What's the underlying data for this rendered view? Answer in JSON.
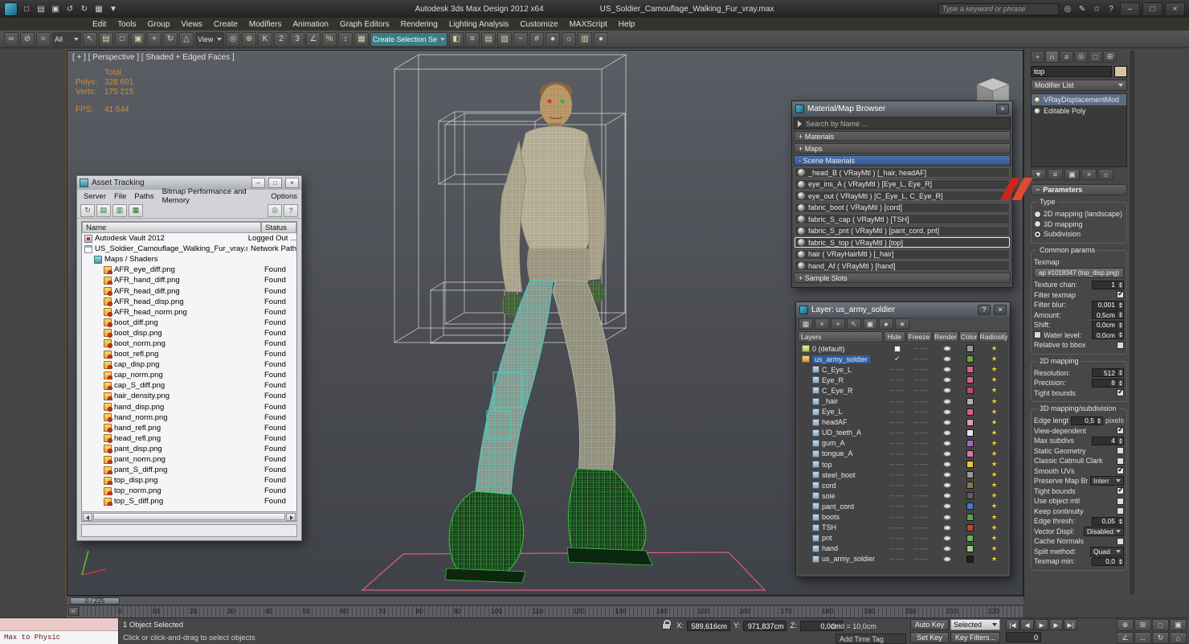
{
  "titlebar": {
    "app_title": "Autodesk 3ds Max Design 2012 x64",
    "file_title": "US_Soldier_Camouflage_Walking_Fur_vray.max",
    "search_placeholder": "Type a keyword or phrase",
    "min": "–",
    "max": "□",
    "close": "×",
    "quick_icons": [
      {
        "n": "new-scene-icon",
        "g": "□"
      },
      {
        "n": "open-file-icon",
        "g": "▤"
      },
      {
        "n": "save-file-icon",
        "g": "▣"
      },
      {
        "n": "undo-icon",
        "g": "↺"
      },
      {
        "n": "redo-icon",
        "g": "↻"
      },
      {
        "n": "project-folder-icon",
        "g": "▦"
      },
      {
        "n": "quick-access-dropdown-icon",
        "g": "▼"
      }
    ],
    "search_icons": [
      {
        "n": "search-icon",
        "g": "◎"
      },
      {
        "n": "pen-icon",
        "g": "✎"
      },
      {
        "n": "favorites-star-icon",
        "g": "☆"
      },
      {
        "n": "help-icon",
        "g": "?"
      }
    ]
  },
  "menubar": [
    "Edit",
    "Tools",
    "Group",
    "Views",
    "Create",
    "Modifiers",
    "Animation",
    "Graph Editors",
    "Rendering",
    "Lighting Analysis",
    "Customize",
    "MAXScript",
    "Help"
  ],
  "toolbar": [
    {
      "n": "select-and-link-icon",
      "g": "∞"
    },
    {
      "n": "unlink-selection-icon",
      "g": "⊘"
    },
    {
      "n": "bind-to-spacewarp-icon",
      "g": "≈"
    },
    {
      "n": "selection-filter-dropdown",
      "g": "All",
      "drop": true
    },
    {
      "n": "select-object-icon",
      "g": "↖"
    },
    {
      "n": "select-by-name-icon",
      "g": "▤"
    },
    {
      "n": "selection-region-icon",
      "g": "□"
    },
    {
      "n": "window-crossing-icon",
      "g": "▣"
    },
    {
      "n": "select-and-move-icon",
      "g": "+"
    },
    {
      "n": "select-and-rotate-icon",
      "g": "↻"
    },
    {
      "n": "select-and-scale-icon",
      "g": "△"
    },
    {
      "n": "reference-coordinate-dropdown",
      "g": "View",
      "drop": true
    },
    {
      "n": "use-center-icon",
      "g": "◎"
    },
    {
      "n": "select-and-manipulate-icon",
      "g": "⊕"
    },
    {
      "n": "keyboard-override-icon",
      "g": "K"
    },
    {
      "n": "snap-2d-icon",
      "g": "2"
    },
    {
      "n": "snap-3d-icon",
      "g": "3"
    },
    {
      "n": "angle-snap-icon",
      "g": "∠"
    },
    {
      "n": "percent-snap-icon",
      "g": "%"
    },
    {
      "n": "spinner-snap-icon",
      "g": "↕"
    },
    {
      "n": "edit-selection-sets-icon",
      "g": "▦"
    },
    {
      "n": "named-selection-dropdown",
      "g": "Create Selection Se",
      "drop": true,
      "teal": true
    },
    {
      "n": "mirror-icon",
      "g": "◧"
    },
    {
      "n": "align-icon",
      "g": "≡"
    },
    {
      "n": "layer-manager-icon",
      "g": "▤"
    },
    {
      "n": "graphite-ribbon-icon",
      "g": "▧"
    },
    {
      "n": "curve-editor-icon",
      "g": "~"
    },
    {
      "n": "schematic-view-icon",
      "g": "#"
    },
    {
      "n": "material-editor-icon",
      "g": "●"
    },
    {
      "n": "render-setup-icon",
      "g": "☼"
    },
    {
      "n": "rendered-frame-icon",
      "g": "▥"
    },
    {
      "n": "render-production-icon",
      "g": "●"
    }
  ],
  "viewport": {
    "label": "[ + ] [ Perspective ] [ Shaded + Edged Faces ]",
    "stats": {
      "total_label": "Total",
      "polys_label": "Polys:",
      "polys": "328 601",
      "verts_label": "Verts:",
      "verts": "175 215",
      "fps_label": "FPS:",
      "fps": "41 644"
    }
  },
  "asset_tracking": {
    "title": "Asset Tracking",
    "min": "–",
    "max": "□",
    "close": "×",
    "menus": [
      "Server",
      "File",
      "Paths",
      "Bitmap Performance and Memory",
      "Options"
    ],
    "tools_left": [
      {
        "n": "refresh-icon",
        "g": "↻"
      },
      {
        "n": "table-view-icon",
        "g": "▤"
      },
      {
        "n": "details-view-icon",
        "g": "▥"
      },
      {
        "n": "list-view-icon",
        "g": "▦"
      }
    ],
    "tools_right": [
      {
        "n": "settings-icon",
        "g": "◎"
      },
      {
        "n": "asset-help-icon",
        "g": "?"
      }
    ],
    "columns": [
      "Name",
      "Status"
    ],
    "rows": [
      {
        "name": "Autodesk Vault 2012",
        "status": "Logged Out ...",
        "icon": "vault-icon",
        "depth": "d0"
      },
      {
        "name": "US_Soldier_Camouflage_Walking_Fur_vray.max",
        "status": "Network Path",
        "icon": "file-icon",
        "depth": "d0"
      },
      {
        "name": "Maps / Shaders",
        "status": "",
        "icon": "folder-icon",
        "depth": "d1"
      },
      {
        "name": "AFR_eye_diff.png",
        "status": "Found",
        "icon": "bitmap-icon",
        "depth": "d2"
      },
      {
        "name": "AFR_hand_diff.png",
        "status": "Found",
        "icon": "bitmap-icon",
        "depth": "d2"
      },
      {
        "name": "AFR_head_diff.png",
        "status": "Found",
        "icon": "bitmap-icon",
        "depth": "d2"
      },
      {
        "name": "AFR_head_disp.png",
        "status": "Found",
        "icon": "bitmap-icon",
        "depth": "d2"
      },
      {
        "name": "AFR_head_norm.png",
        "status": "Found",
        "icon": "bitmap-icon",
        "depth": "d2"
      },
      {
        "name": "boot_diff.png",
        "status": "Found",
        "icon": "bitmap-icon",
        "depth": "d2"
      },
      {
        "name": "boot_disp.png",
        "status": "Found",
        "icon": "bitmap-icon",
        "depth": "d2"
      },
      {
        "name": "boot_norm.png",
        "status": "Found",
        "icon": "bitmap-icon",
        "depth": "d2"
      },
      {
        "name": "boot_refl.png",
        "status": "Found",
        "icon": "bitmap-icon",
        "depth": "d2"
      },
      {
        "name": "cap_disp.png",
        "status": "Found",
        "icon": "bitmap-icon",
        "depth": "d2"
      },
      {
        "name": "cap_norm.png",
        "status": "Found",
        "icon": "bitmap-icon",
        "depth": "d2"
      },
      {
        "name": "cap_S_diff.png",
        "status": "Found",
        "icon": "bitmap-icon",
        "depth": "d2"
      },
      {
        "name": "hair_density.png",
        "status": "Found",
        "icon": "bitmap-icon",
        "depth": "d2"
      },
      {
        "name": "hand_disp.png",
        "status": "Found",
        "icon": "bitmap-icon",
        "depth": "d2"
      },
      {
        "name": "hand_norm.png",
        "status": "Found",
        "icon": "bitmap-icon",
        "depth": "d2"
      },
      {
        "name": "hand_refl.png",
        "status": "Found",
        "icon": "bitmap-icon",
        "depth": "d2"
      },
      {
        "name": "head_refl.png",
        "status": "Found",
        "icon": "bitmap-icon",
        "depth": "d2"
      },
      {
        "name": "pant_disp.png",
        "status": "Found",
        "icon": "bitmap-icon",
        "depth": "d2"
      },
      {
        "name": "pant_norm.png",
        "status": "Found",
        "icon": "bitmap-icon",
        "depth": "d2"
      },
      {
        "name": "pant_S_diff.png",
        "status": "Found",
        "icon": "bitmap-icon",
        "depth": "d2"
      },
      {
        "name": "top_disp.png",
        "status": "Found",
        "icon": "bitmap-icon",
        "depth": "d2"
      },
      {
        "name": "top_norm.png",
        "status": "Found",
        "icon": "bitmap-icon",
        "depth": "d2"
      },
      {
        "name": "top_S_diff.png",
        "status": "Found",
        "icon": "bitmap-icon",
        "depth": "d2"
      }
    ]
  },
  "material_browser": {
    "title": "Material/Map Browser",
    "close": "×",
    "search_placeholder": "Search by Name ...",
    "rollups": [
      "+ Materials",
      "+ Maps",
      "- Scene Materials",
      "+ Sample Slots"
    ],
    "items": [
      {
        "label": "_head_B ( VRayMtl ) [_hair, headAF]",
        "sel": false
      },
      {
        "label": "eye_ins_A ( VRayMtl ) [Eye_L, Eye_R]",
        "sel": false
      },
      {
        "label": "eye_out ( VRayMtl ) [C_Eye_L, C_Eye_R]",
        "sel": false
      },
      {
        "label": "fabric_boot ( VRayMtl ) [cord]",
        "sel": false
      },
      {
        "label": "fabric_S_cap ( VRayMtl ) [TSH]",
        "sel": false
      },
      {
        "label": "fabric_S_pnt ( VRayMtl ) [pant_cord, pnt]",
        "sel": false
      },
      {
        "label": "fabric_S_top ( VRayMtl ) [top]",
        "sel": true
      },
      {
        "label": "hair ( VRayHairMtl ) [_hair]",
        "sel": false
      },
      {
        "label": "hand_Af ( VRayMtl ) [hand]",
        "sel": false
      }
    ]
  },
  "layer_manager": {
    "title": "Layer: us_army_soldier",
    "help": "?",
    "close": "×",
    "tools": [
      {
        "n": "new-layer-icon",
        "g": "▦"
      },
      {
        "n": "delete-layer-icon",
        "g": "×"
      },
      {
        "n": "add-to-layer-icon",
        "g": "+"
      },
      {
        "n": "select-in-layer-icon",
        "g": "↖"
      },
      {
        "n": "highlight-layer-icon",
        "g": "▣"
      },
      {
        "n": "hide-all-icon",
        "g": "●"
      },
      {
        "n": "freeze-all-icon",
        "g": "∗"
      }
    ],
    "columns": [
      "Layers",
      "Hide",
      "Freeze",
      "Render",
      "Color",
      "Radiosity"
    ],
    "rows": [
      {
        "name": "0 (default)",
        "kind": "layer0",
        "sel": false,
        "hide": "",
        "freeze": "-----",
        "color": "#9a9a9a"
      },
      {
        "name": "us_army_soldier",
        "kind": "current",
        "sel": true,
        "hide": "",
        "freeze": "-----",
        "color": "#6fa544"
      },
      {
        "name": "C_Eye_L",
        "kind": "object",
        "sel": false,
        "hide": "-----",
        "freeze": "-----",
        "color": "#d8608c"
      },
      {
        "name": "Eye_R",
        "kind": "object",
        "sel": false,
        "hide": "-----",
        "freeze": "-----",
        "color": "#d8608c"
      },
      {
        "name": "C_Eye_R",
        "kind": "object",
        "sel": false,
        "hide": "-----",
        "freeze": "-----",
        "color": "#c04878"
      },
      {
        "name": "_hair",
        "kind": "object",
        "sel": false,
        "hide": "-----",
        "freeze": "-----",
        "color": "#b0b0b0"
      },
      {
        "name": "Eye_L",
        "kind": "object",
        "sel": false,
        "hide": "-----",
        "freeze": "-----",
        "color": "#d8608c"
      },
      {
        "name": "headAF",
        "kind": "object",
        "sel": false,
        "hide": "-----",
        "freeze": "-----",
        "color": "#e09ab8"
      },
      {
        "name": "UD_teeth_A",
        "kind": "object",
        "sel": false,
        "hide": "-----",
        "freeze": "-----",
        "color": "#e8e8e8"
      },
      {
        "name": "gum_A",
        "kind": "object",
        "sel": false,
        "hide": "-----",
        "freeze": "-----",
        "color": "#b060c8"
      },
      {
        "name": "tongue_A",
        "kind": "object",
        "sel": false,
        "hide": "-----",
        "freeze": "-----",
        "color": "#e078a8"
      },
      {
        "name": "top",
        "kind": "object",
        "sel": false,
        "hide": "-----",
        "freeze": "-----",
        "color": "#e6c838"
      },
      {
        "name": "steel_boot",
        "kind": "object",
        "sel": false,
        "hide": "-----",
        "freeze": "-----",
        "color": "#9a9a9a"
      },
      {
        "name": "cord",
        "kind": "object",
        "sel": false,
        "hide": "-----",
        "freeze": "-----",
        "color": "#8a7a4a"
      },
      {
        "name": "sole",
        "kind": "object",
        "sel": false,
        "hide": "-----",
        "freeze": "-----",
        "color": "#606060"
      },
      {
        "name": "pant_cord",
        "kind": "object",
        "sel": false,
        "hide": "-----",
        "freeze": "-----",
        "color": "#4878c8"
      },
      {
        "name": "boots",
        "kind": "object",
        "sel": false,
        "hide": "-----",
        "freeze": "-----",
        "color": "#58a848"
      },
      {
        "name": "TSH",
        "kind": "object",
        "sel": false,
        "hide": "-----",
        "freeze": "-----",
        "color": "#c84040"
      },
      {
        "name": "pnt",
        "kind": "object",
        "sel": false,
        "hide": "-----",
        "freeze": "-----",
        "color": "#68b058"
      },
      {
        "name": "hand",
        "kind": "object",
        "sel": false,
        "hide": "-----",
        "freeze": "-----",
        "color": "#98d080"
      },
      {
        "name": "us_army_soldier",
        "kind": "object",
        "sel": false,
        "hide": "-----",
        "freeze": "-----",
        "color": "#1e1e1e"
      }
    ]
  },
  "command_panel": {
    "tabs": [
      {
        "n": "create-tab-icon",
        "g": "+",
        "act": false
      },
      {
        "n": "modify-tab-icon",
        "g": "∩",
        "act": true
      },
      {
        "n": "hierarchy-tab-icon",
        "g": "≡",
        "act": false
      },
      {
        "n": "motion-tab-icon",
        "g": "◎",
        "act": false
      },
      {
        "n": "display-tab-icon",
        "g": "□",
        "act": false
      },
      {
        "n": "utilities-tab-icon",
        "g": "⊞",
        "act": false
      }
    ],
    "object_name": "top",
    "modifier_list": "Modifier List",
    "stack": [
      {
        "label": "VRayDisplacementMod",
        "sel": true
      },
      {
        "label": "Editable Poly",
        "sel": false
      }
    ],
    "stack_tools": [
      {
        "n": "pin-stack-icon",
        "g": "▼"
      },
      {
        "n": "show-end-result-icon",
        "g": "≡"
      },
      {
        "n": "make-unique-icon",
        "g": "▣"
      },
      {
        "n": "remove-modifier-icon",
        "g": "×"
      },
      {
        "n": "configure-modifier-icon",
        "g": "☼"
      }
    ],
    "rollout_title": "Parameters",
    "type_label": "Type",
    "type_options": [
      {
        "label": "2D mapping (landscape)",
        "on": false
      },
      {
        "label": "3D mapping",
        "on": false
      },
      {
        "label": "Subdivision",
        "on": true
      }
    ],
    "common_label": "Common params",
    "texmap_label": "Texmap",
    "texmap_value": "ap #1018347 (top_disp.png)",
    "texture_chan_label": "Texture chan:",
    "texture_chan": "1",
    "filter_texmap_label": "Filter texmap",
    "filter_texmap_on": true,
    "filter_blur_label": "Filter blur:",
    "filter_blur": "0,001",
    "amount_label": "Amount:",
    "amount": "0,5cm",
    "shift_label": "Shift:",
    "shift": "0,0cm",
    "water_label": "Water level:",
    "water": "0,0cm",
    "water_on": false,
    "relative_label": "Relative to bbox",
    "relative_on": false,
    "m2d_label": "2D mapping",
    "resolution_label": "Resolution:",
    "resolution": "512",
    "precision_label": "Precision:",
    "precision": "8",
    "tight2d_label": "Tight bounds",
    "tight2d_on": true,
    "m3d_label": "3D mapping/subdivision",
    "edge_length_label": "Edge length",
    "edge_length": "0,5",
    "edge_length_unit": "pixels",
    "view_dep_label": "View-dependent",
    "view_dep_on": true,
    "max_subdivs_label": "Max subdivs",
    "max_subdivs": "4",
    "static_geo_label": "Static Geometry",
    "static_geo_on": false,
    "catmull_label": "Classic Catmull Clark",
    "catmull_on": false,
    "smooth_uvs_label": "Smooth UVs",
    "smooth_uvs_on": true,
    "preserve_label": "Preserve Map Bnd",
    "preserve_value": "Interr",
    "tight3d_label": "Tight bounds",
    "tight3d_on": true,
    "use_obj_mtl_label": "Use object mtl",
    "use_obj_mtl_on": false,
    "keep_cont_label": "Keep continuity",
    "keep_cont_on": false,
    "edge_thresh_label": "Edge thresh:",
    "edge_thresh": "0,05",
    "vector_displ_label": "Vector Displ:",
    "vector_displ": "Disabled",
    "cache_normals_label": "Cache Normals",
    "cache_normals_on": false,
    "split_method_label": "Split method:",
    "split_method": "Quad",
    "texmap_min_label": "Texmap min:",
    "texmap_min": "0,0"
  },
  "trackbar": {
    "slider_label": "0 / 225",
    "mce_glyph": "≈",
    "ticks": [
      "0",
      "10",
      "20",
      "30",
      "40",
      "50",
      "60",
      "70",
      "80",
      "90",
      "100",
      "110",
      "120",
      "130",
      "140",
      "150",
      "160",
      "170",
      "180",
      "190",
      "200",
      "210",
      "220"
    ]
  },
  "statusbar": {
    "listener_text": "Max to Physic",
    "selection_status": "1 Object Selected",
    "prompt": "Click or click-and-drag to select objects",
    "x_label": "X:",
    "x": "589,616cm",
    "y_label": "Y:",
    "y": "971,837cm",
    "z_label": "Z:",
    "z": "0,0cm",
    "grid": "Grid = 10,0cm",
    "add_time_tag": "Add Time Tag",
    "auto_key": "Auto Key",
    "selected_dropdown": "Selected",
    "set_key": "Set Key",
    "key_filters": "Key Filters...",
    "frame": "0",
    "playback": [
      {
        "n": "go-to-start-button",
        "g": "|◀"
      },
      {
        "n": "previous-frame-button",
        "g": "◀"
      },
      {
        "n": "play-button",
        "g": "▶"
      },
      {
        "n": "next-frame-button",
        "g": "▶"
      },
      {
        "n": "go-to-end-button",
        "g": "▶|"
      }
    ],
    "nav": [
      {
        "n": "zoom-icon",
        "g": "⊕"
      },
      {
        "n": "zoom-all-icon",
        "g": "⊞"
      },
      {
        "n": "zoom-extents-icon",
        "g": "□"
      },
      {
        "n": "zoom-extents-all-icon",
        "g": "▣"
      },
      {
        "n": "fov-icon",
        "g": "∠"
      },
      {
        "n": "pan-icon",
        "g": "↔"
      },
      {
        "n": "orbit-icon",
        "g": "↻"
      },
      {
        "n": "maximize-viewport-icon",
        "g": "⌂"
      }
    ]
  }
}
